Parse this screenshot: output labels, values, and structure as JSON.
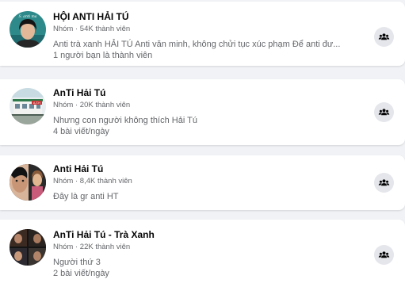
{
  "groups": [
    {
      "name": "HỘI ANTI HẢI TÚ",
      "meta": "Nhóm · 54K thành viên",
      "line1": "Anti trà xanh HẢI TÚ Anti văn minh, không chửi tục xúc phạm Để anti đư...",
      "line2": "1 người bạn là thành viên",
      "avatar_text": "S. anti ma"
    },
    {
      "name": "AnTi Hải Tú",
      "meta": "Nhóm · 20K thành viên",
      "line1": "Nhưng con người không thích Hải Tú",
      "line2": "4 bài viết/ngày",
      "avatar_text": "A.T.H"
    },
    {
      "name": "Anti Hải Tú",
      "meta": "Nhóm · 8,4K thành viên",
      "line1": "Đây là gr anti HT",
      "line2": ""
    },
    {
      "name": "AnTi Hải Tú - Trà Xanh",
      "meta": "Nhóm · 22K thành viên",
      "line1": "Người thứ 3",
      "line2": "2 bài viết/ngày"
    }
  ],
  "icons": {
    "join": "group-icon"
  },
  "colors": {
    "background": "#f0f2f5",
    "card": "#ffffff",
    "secondary_text": "#65676b",
    "icon_button": "#e4e6eb"
  }
}
